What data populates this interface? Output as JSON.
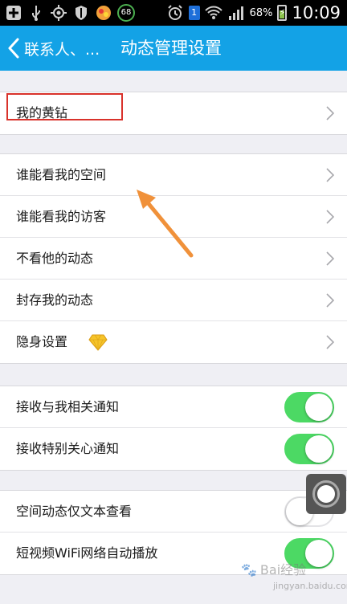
{
  "status_bar": {
    "badge": "68",
    "notification_count": "1",
    "battery_percent": "68%",
    "time": "10:09"
  },
  "title_bar": {
    "back_label": "联系人、...",
    "title": "动态管理设置"
  },
  "groups": [
    {
      "rows": [
        {
          "label": "我的黄钻",
          "control": "chevron"
        }
      ]
    },
    {
      "rows": [
        {
          "label": "谁能看我的空间",
          "control": "chevron"
        },
        {
          "label": "谁能看我的访客",
          "control": "chevron"
        },
        {
          "label": "不看他的动态",
          "control": "chevron"
        },
        {
          "label": "封存我的动态",
          "control": "chevron"
        },
        {
          "label": "隐身设置",
          "control": "chevron",
          "icon": "diamond-icon"
        }
      ]
    },
    {
      "rows": [
        {
          "label": "接收与我相关通知",
          "control": "toggle",
          "on": true
        },
        {
          "label": "接收特别关心通知",
          "control": "toggle",
          "on": true
        }
      ]
    },
    {
      "rows": [
        {
          "label": "空间动态仅文本查看",
          "control": "toggle",
          "on": false
        },
        {
          "label": "短视频WiFi网络自动播放",
          "control": "toggle",
          "on": true
        }
      ]
    }
  ],
  "watermark": {
    "text": "Bai经验",
    "sub": "jingyan.baidu.com"
  },
  "colors": {
    "title_bar": "#13a2e6",
    "toggle_on": "#4cd964",
    "annotation": "#d9322b",
    "arrow": "#f0913a"
  }
}
